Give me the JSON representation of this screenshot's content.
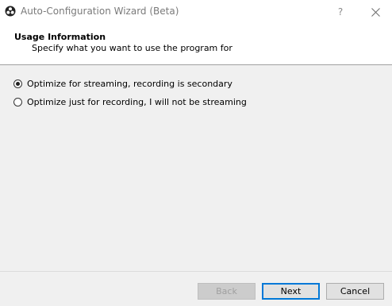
{
  "window": {
    "title": "Auto-Configuration Wizard (Beta)",
    "help_label": "?",
    "app_icon": "obs-logo-icon",
    "close_icon": "close-icon"
  },
  "header": {
    "title": "Usage Information",
    "subtitle": "Specify what you want to use the program for"
  },
  "options": [
    {
      "label": "Optimize for streaming, recording is secondary",
      "selected": true
    },
    {
      "label": "Optimize just for recording, I will not be streaming",
      "selected": false
    }
  ],
  "buttons": {
    "back": "Back",
    "next": "Next",
    "cancel": "Cancel"
  },
  "colors": {
    "accent": "#0078d7",
    "title_text": "#7a7a7a"
  }
}
